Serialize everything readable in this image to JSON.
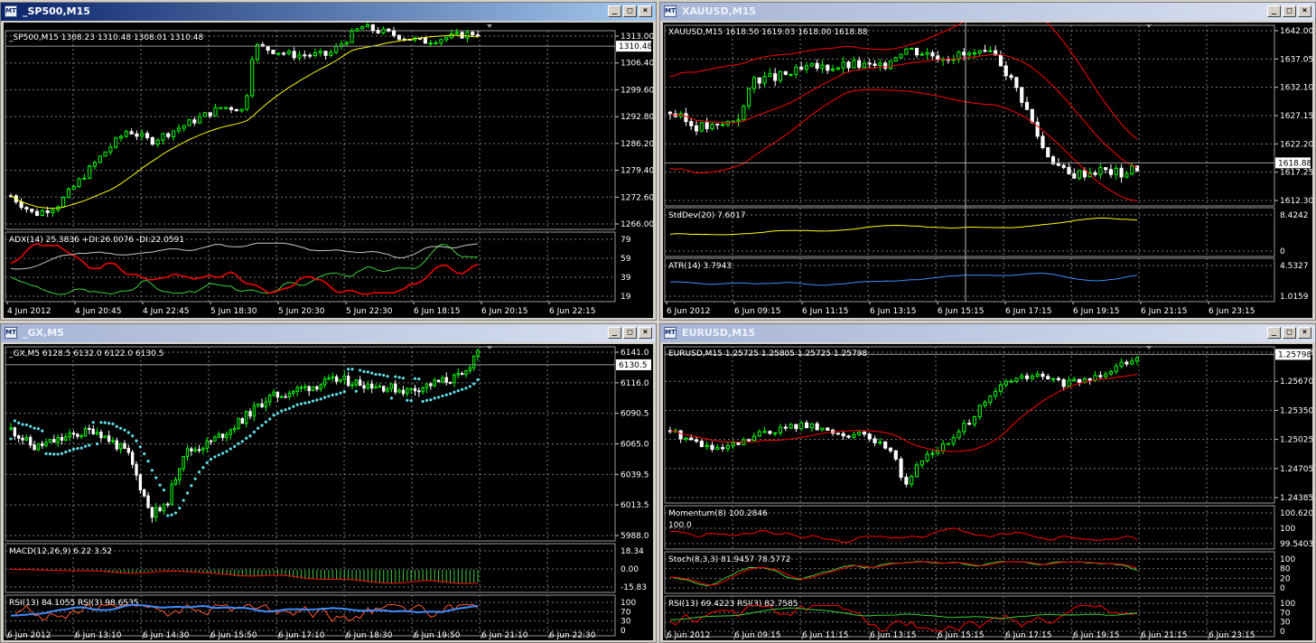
{
  "colors": {
    "bull": "#00ff00",
    "bear": "#ffffff",
    "grid": "#7a7a7a",
    "yellow": "#ffff00",
    "red": "#ff0000",
    "aqua": "#5fe0e8",
    "blue": "#3f8cff",
    "orange": "#ff5a28",
    "green": "#3ad03a"
  },
  "windows": [
    {
      "title": "_SP500,M15",
      "active": true,
      "buttons": {
        "minimize": "_",
        "maximize": "□",
        "close": "×"
      },
      "main_label": "_SP500,M15  1308.23 1310.48 1308.01 1310.48",
      "price_ticks": [
        "1313.00",
        "1306.40",
        "1299.60",
        "1292.80",
        "1286.20",
        "1279.40",
        "1272.60",
        "1266.00"
      ],
      "price_range": [
        1266.0,
        1313.0
      ],
      "current_price": "1310.48",
      "time_labels": [
        "4 Jun 2012",
        "4 Jun 20:45",
        "4 Jun 22:45",
        "5 Jun 18:30",
        "5 Jun 20:30",
        "5 Jun 22:30",
        "6 Jun 18:15",
        "6 Jun 20:15",
        "6 Jun 22:15"
      ],
      "indicators": [
        {
          "label": "ADX(14) 25.3836  +DI:26.0076  -DI:22.0591",
          "ticks": [
            "79",
            "59",
            "39",
            "19"
          ],
          "range": [
            0,
            90
          ]
        }
      ]
    },
    {
      "title": "XAUUSD,M15",
      "active": false,
      "buttons": {
        "minimize": "_",
        "maximize": "□",
        "close": "×"
      },
      "main_label": "XAUUSD,M15  1618.50 1619.03 1618.00 1618.88",
      "price_ticks": [
        "1642.00",
        "1637.05",
        "1632.10",
        "1627.15",
        "1622.20",
        "1617.25",
        "1612.30"
      ],
      "price_range": [
        1612.3,
        1642.0
      ],
      "current_price": "1618.88",
      "time_labels": [
        "6 Jun 2012",
        "6 Jun 09:15",
        "6 Jun 11:15",
        "6 Jun 13:15",
        "6 Jun 15:15",
        "6 Jun 17:15",
        "6 Jun 19:15",
        "6 Jun 21:15",
        "6 Jun 23:15"
      ],
      "indicators": [
        {
          "label": "StdDev(20) 7.6017",
          "ticks": [
            "8.4242",
            "0"
          ],
          "range": [
            0,
            9
          ]
        },
        {
          "label": "ATR(14) 3.7943",
          "ticks": [
            "4.5327",
            "1.0159"
          ],
          "range": [
            0.8,
            4.9
          ]
        }
      ]
    },
    {
      "title": "_GX,M5",
      "active": false,
      "buttons": {
        "minimize": "_",
        "maximize": "□",
        "close": "×"
      },
      "main_label": "_GX,M5  6128.5 6132.0 6122.0 6130.5",
      "price_ticks": [
        "6141.0",
        "6116.0",
        "6090.5",
        "6065.0",
        "6039.5",
        "6013.5",
        "5988.0"
      ],
      "price_range": [
        5988.0,
        6141.0
      ],
      "current_price": "6130.5",
      "time_labels": [
        "6 Jun 2012",
        "6 Jun 13:10",
        "6 Jun 14:30",
        "6 Jun 15:50",
        "6 Jun 17:10",
        "6 Jun 18:30",
        "6 Jun 19:50",
        "6 Jun 21:10",
        "6 Jun 22:30"
      ],
      "indicators": [
        {
          "label": "MACD(12,26,9) 6.22 3.52",
          "ticks": [
            "18.34",
            "0.00",
            "-15.83"
          ],
          "range": [
            -20,
            22
          ]
        },
        {
          "label": "RSI(13) 84.1055  RSI(3) 98.6535",
          "ticks": [
            "100",
            "70",
            "30",
            "0"
          ],
          "range": [
            0,
            100
          ]
        }
      ]
    },
    {
      "title": "EURUSD,M15",
      "active": false,
      "buttons": {
        "minimize": "_",
        "maximize": "□",
        "close": "×"
      },
      "main_label": "EURUSD,M15  1.25725 1.25805 1.25725 1.25798",
      "price_ticks": [
        "1.25798",
        "1.25670",
        "1.25350",
        "1.25025",
        "1.24705",
        "1.24385"
      ],
      "price_range": [
        1.2436,
        1.2582
      ],
      "current_price": "1.25798",
      "time_labels": [
        "6 Jun 2012",
        "6 Jun 09:15",
        "6 Jun 11:15",
        "6 Jun 13:15",
        "6 Jun 15:15",
        "6 Jun 17:15",
        "6 Jun 19:15",
        "6 Jun 21:15",
        "6 Jun 23:15"
      ],
      "indicators": [
        {
          "label": "Momentum(8) 100.2846",
          "ticks": [
            "100.6206",
            "100",
            "99.5403"
          ],
          "range": [
            99.5,
            100.7
          ],
          "extra_label": "100.0"
        },
        {
          "label": "Stoch(8,3,3) 81.9457 78.5772",
          "ticks": [
            "100",
            "80",
            "20",
            "0"
          ],
          "range": [
            0,
            100
          ]
        },
        {
          "label": "RSI(13) 69.4223  RSI(3) 82.7585",
          "ticks": [
            "100",
            "70",
            "30",
            "0"
          ],
          "range": [
            0,
            100
          ]
        }
      ]
    }
  ]
}
